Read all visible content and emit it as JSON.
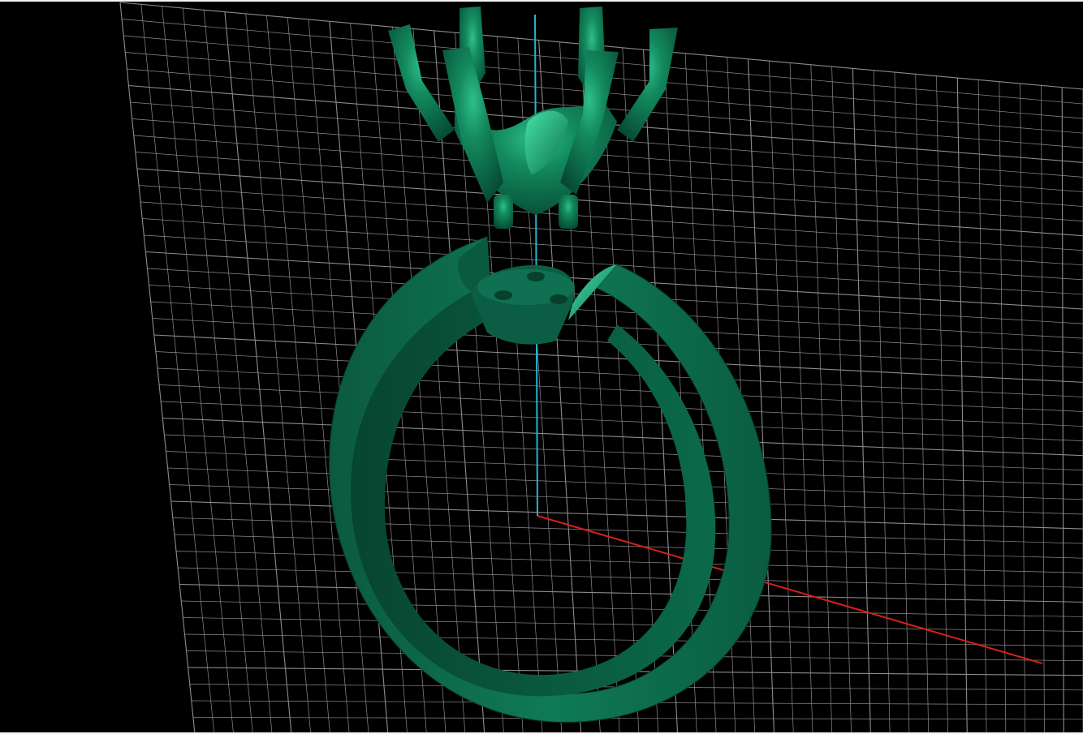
{
  "viewport": {
    "background": "#000000",
    "grid_color": "#8c8c8c",
    "model_color": "#0e6e50",
    "axes": {
      "x_axis_color": "#d8201a",
      "z_axis_color": "#21b7d0"
    },
    "objects": [
      {
        "name": "ring-shank"
      },
      {
        "name": "head-seat-with-holes"
      },
      {
        "name": "six-prong-crown-setting"
      }
    ]
  }
}
